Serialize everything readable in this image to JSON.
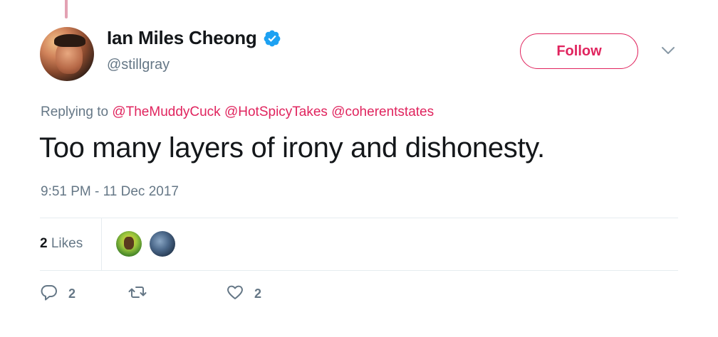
{
  "author": {
    "display_name": "Ian Miles Cheong",
    "handle": "@stillgray",
    "verified": true
  },
  "follow_button": {
    "label": "Follow"
  },
  "reply_context": {
    "prefix": "Replying to",
    "mentions": [
      "@TheMuddyCuck",
      "@HotSpicyTakes",
      "@coherentstates"
    ]
  },
  "tweet": {
    "text": "Too many layers of irony and dishonesty.",
    "timestamp": "9:51 PM - 11 Dec 2017"
  },
  "stats": {
    "likes_count": "2",
    "likes_label": "Likes"
  },
  "actions": {
    "reply_count": "2",
    "retweet_count": "",
    "like_count": "2"
  },
  "icons": {
    "verified": "verified-badge-icon",
    "caret": "chevron-down-icon",
    "reply": "reply-icon",
    "retweet": "retweet-icon",
    "like": "heart-icon"
  },
  "colors": {
    "accent": "#e0245e",
    "verified_blue": "#1da1f2",
    "secondary_text": "#657786",
    "thread_line": "#e3a2b3"
  }
}
